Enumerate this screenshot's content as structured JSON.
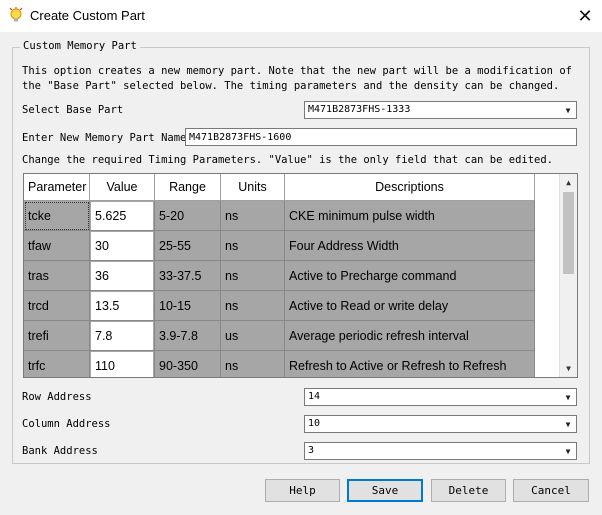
{
  "window": {
    "title": "Create Custom Part",
    "close_glyph": "✕"
  },
  "group": {
    "legend": "Custom Memory Part"
  },
  "description": "This option creates a new memory part. Note that the new part will be a modification of the \"Base Part\" selected below. The timing parameters and the density can be changed.",
  "base_part": {
    "label": "Select Base Part",
    "value": "M471B2873FHS-1333"
  },
  "new_name": {
    "label": "Enter New Memory Part Name",
    "value": "M471B2873FHS-1600"
  },
  "timing_note": "Change the required Timing Parameters. \"Value\" is the only field that can be edited.",
  "table": {
    "headers": [
      "Parameter",
      "Value",
      "Range",
      "Units",
      "Descriptions"
    ],
    "rows": [
      [
        "tcke",
        "5.625",
        "5-20",
        "ns",
        "CKE minimum pulse width"
      ],
      [
        "tfaw",
        "30",
        "25-55",
        "ns",
        "Four Address Width"
      ],
      [
        "tras",
        "36",
        "33-37.5",
        "ns",
        "Active to Precharge command"
      ],
      [
        "trcd",
        "13.5",
        "10-15",
        "ns",
        "Active to Read or write delay"
      ],
      [
        "trefi",
        "7.8",
        "3.9-7.8",
        "us",
        "Average periodic refresh interval"
      ],
      [
        "trfc",
        "110",
        "90-350",
        "ns",
        "Refresh to Active or Refresh to Refresh"
      ]
    ]
  },
  "row_address": {
    "label": "Row Address",
    "value": "14"
  },
  "column_address": {
    "label": "Column Address",
    "value": "10"
  },
  "bank_address": {
    "label": "Bank Address",
    "value": "3"
  },
  "buttons": {
    "help": "Help",
    "save": "Save",
    "delete": "Delete",
    "cancel": "Cancel"
  },
  "icons": {
    "app": "lightbulb-icon",
    "dropdown": "chevron-down-icon",
    "scroll_up": "scroll-up-icon",
    "scroll_down": "scroll-down-icon"
  }
}
